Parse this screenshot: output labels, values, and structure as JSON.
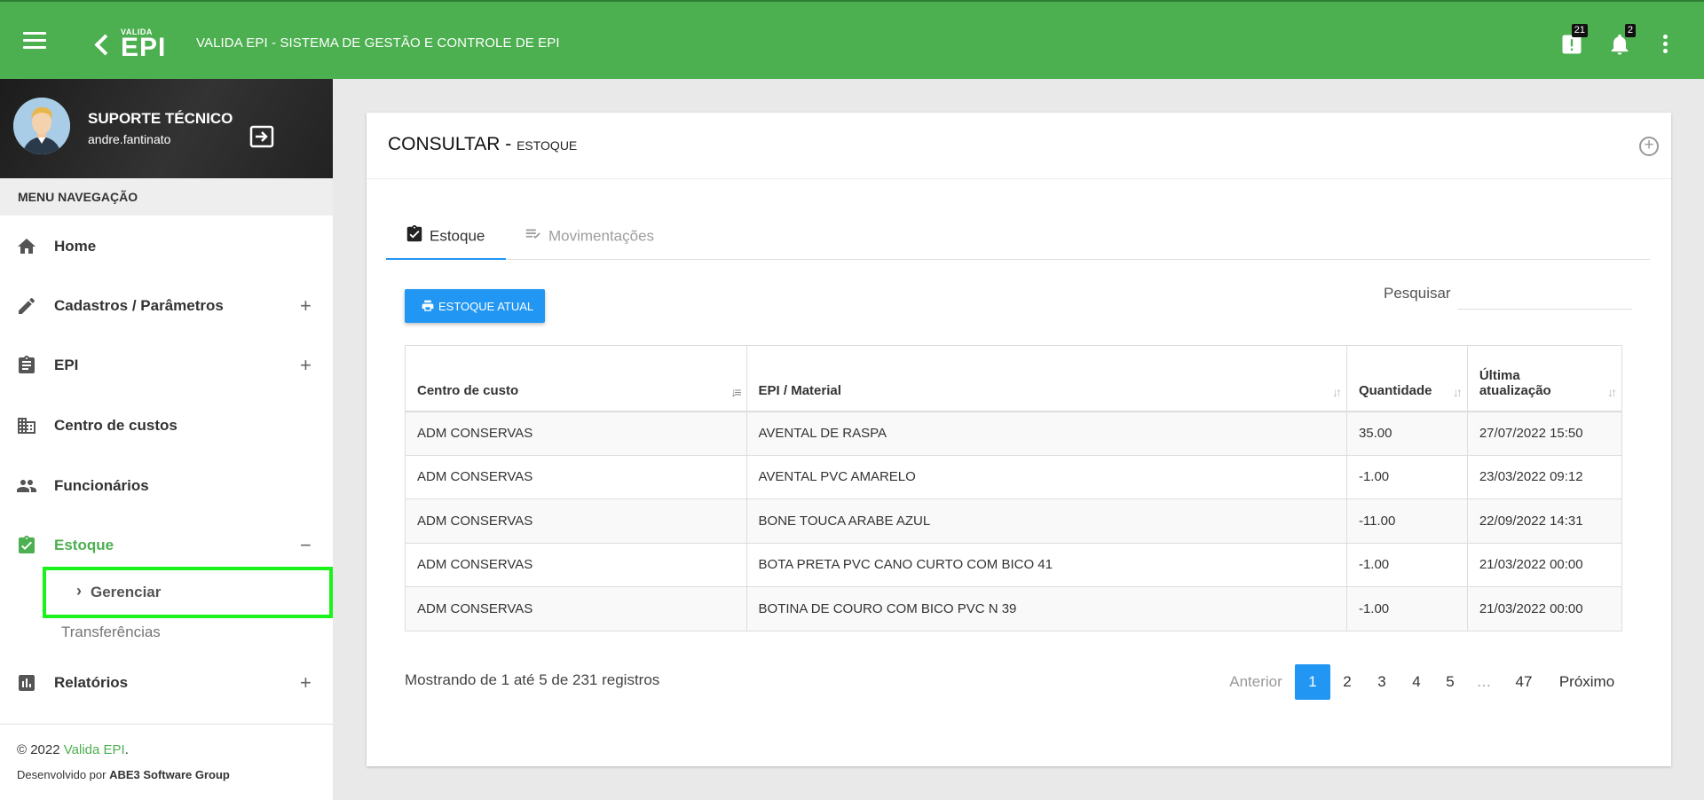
{
  "header": {
    "logo_small": "VALIDA",
    "logo_big": "EPI",
    "title": "VALIDA EPI - SISTEMA DE GESTÃO E CONTROLE DE EPI",
    "alerts_badge": "21",
    "notifications_badge": "2"
  },
  "user": {
    "name": "SUPORTE TÉCNICO",
    "login": "andre.fantinato"
  },
  "sidebar": {
    "menu_header": "MENU NAVEGAÇÃO",
    "items": [
      {
        "label": "Home",
        "icon": "home-icon"
      },
      {
        "label": "Cadastros / Parâmetros",
        "icon": "pencil-icon",
        "toggle": "+"
      },
      {
        "label": "EPI",
        "icon": "clipboard-icon",
        "toggle": "+"
      },
      {
        "label": "Centro de custos",
        "icon": "building-icon"
      },
      {
        "label": "Funcionários",
        "icon": "people-icon"
      },
      {
        "label": "Estoque",
        "icon": "clipboard-check-icon",
        "toggle": "−"
      },
      {
        "label": "Relatórios",
        "icon": "bar-chart-icon",
        "toggle": "+"
      }
    ],
    "subitems": {
      "gerenciar": "Gerenciar",
      "transferencias": "Transferências"
    },
    "footer": {
      "copy_prefix": "© 2022 ",
      "copy_link": "Valida EPI",
      "copy_suffix": ".",
      "dev_prefix": "Desenvolvido por ",
      "dev_company": "ABE3 Software Group"
    }
  },
  "card": {
    "title": "CONSULTAR - ",
    "subtitle": "ESTOQUE",
    "tabs": [
      {
        "label": "Estoque"
      },
      {
        "label": "Movimentações"
      }
    ],
    "button_label": "ESTOQUE ATUAL",
    "search_label": "Pesquisar",
    "search_value": ""
  },
  "table": {
    "headers": [
      "Centro de custo",
      "EPI / Material",
      "Quantidade",
      "Última atualização"
    ],
    "rows": [
      [
        "ADM CONSERVAS",
        "AVENTAL DE RASPA",
        "35.00",
        "27/07/2022 15:50"
      ],
      [
        "ADM CONSERVAS",
        "AVENTAL PVC AMARELO",
        "-1.00",
        "23/03/2022 09:12"
      ],
      [
        "ADM CONSERVAS",
        "BONE TOUCA ARABE AZUL",
        "-11.00",
        "22/09/2022 14:31"
      ],
      [
        "ADM CONSERVAS",
        "BOTA PRETA PVC CANO CURTO COM BICO 41",
        "-1.00",
        "21/03/2022 00:00"
      ],
      [
        "ADM CONSERVAS",
        "BOTINA DE COURO COM BICO PVC N 39",
        "-1.00",
        "21/03/2022 00:00"
      ]
    ]
  },
  "pagination": {
    "info": "Mostrando de 1 até 5 de 231 registros",
    "previous": "Anterior",
    "pages": [
      "1",
      "2",
      "3",
      "4",
      "5"
    ],
    "ellipsis": "…",
    "last": "47",
    "next": "Próximo",
    "current": "1"
  },
  "colors": {
    "brand_green": "#4caf50",
    "accent_blue": "#2196f3",
    "highlight": "#19f31a"
  }
}
